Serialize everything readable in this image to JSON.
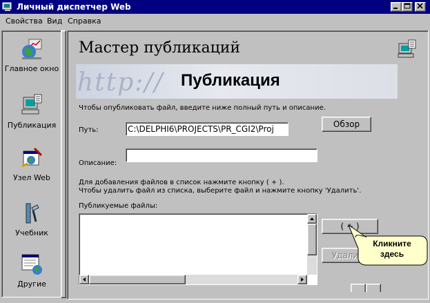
{
  "window": {
    "title": "Личный диспетчер Web"
  },
  "menu": {
    "items": [
      {
        "label": "Свойства",
        "accel": "С"
      },
      {
        "label": "Вид",
        "accel": "В"
      },
      {
        "label": "Справка",
        "accel": "С"
      }
    ]
  },
  "sidebar": {
    "items": [
      {
        "label": "Главное окно",
        "icon": "home-globe-icon"
      },
      {
        "label": "Публикация",
        "icon": "publish-computer-icon"
      },
      {
        "label": "Узел Web",
        "icon": "web-node-icon"
      },
      {
        "label": "Учебник",
        "icon": "tutorial-tools-icon"
      },
      {
        "label": "Другие",
        "icon": "other-window-icon"
      }
    ]
  },
  "main": {
    "title": "Мастер публикаций",
    "banner_bg_text": "http://",
    "banner_title": "Публикация",
    "instruction": "Чтобы опубликовать файл, введите ниже полный путь и описание.",
    "path_label": "Путь:",
    "path_value": "C:\\DELPHI6\\PROJECTS\\PR_CGI2\\Proj",
    "browse_button": "Обзор",
    "description_label": "Описание:",
    "description_value": "",
    "help_line1": "Для добавления файлов в список нажмите кнопку ( + ).",
    "help_line2": "Чтобы удалить файл из списка, выберите файл и нажмите кнопку 'Удалить'.",
    "files_label": "Публикуемые файлы:",
    "add_button": "( + )",
    "delete_button": "Удалить"
  },
  "callout": {
    "line1": "Кликните",
    "line2": "здесь"
  },
  "colors": {
    "titlebar": "#000080",
    "callout_fill": "#ffffcc",
    "window_bg": "#c0c0c0"
  }
}
